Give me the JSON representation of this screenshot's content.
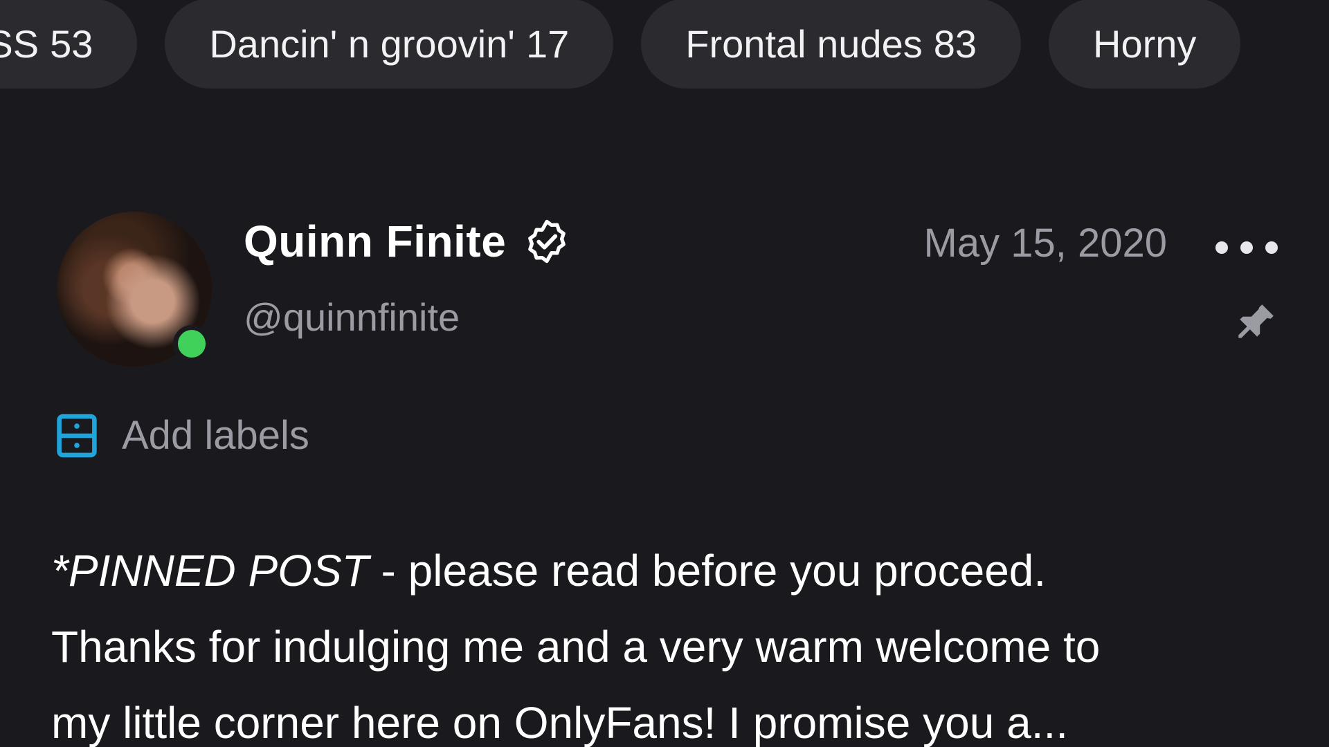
{
  "categories": [
    {
      "name": "ASS",
      "count": "53"
    },
    {
      "name": "Dancin' n groovin'",
      "count": "17"
    },
    {
      "name": "Frontal nudes",
      "count": "83"
    },
    {
      "name": "Horny",
      "count": ""
    }
  ],
  "post": {
    "author_name": "Quinn Finite",
    "author_handle": "@quinnfinite",
    "date": "May 15, 2020",
    "add_labels": "Add labels",
    "text_pinned": "*PINNED POST",
    "text_line1_rest": " - please read before you proceed.",
    "text_line2": "Thanks for indulging me and a very warm welcome to",
    "text_line3": "my little corner here on OnlyFans! I promise you a..."
  },
  "icons": {
    "verified": "verified-badge-icon",
    "more": "more-options-icon",
    "pin": "pin-icon",
    "labels": "labels-icon"
  },
  "colors": {
    "background": "#1a191e",
    "chip": "#2a2a2f",
    "muted_text": "#9b9ba3",
    "online": "#3fd15a",
    "accent": "#1fa5dc"
  }
}
